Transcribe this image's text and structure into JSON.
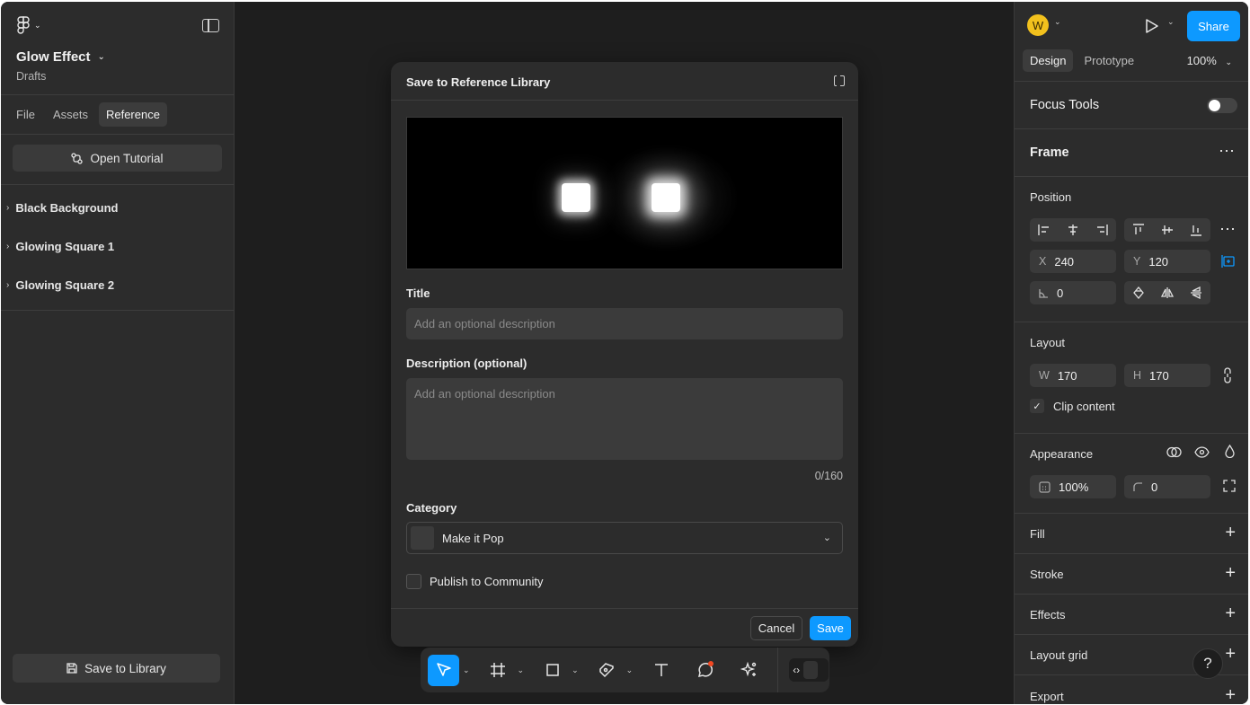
{
  "file": {
    "title": "Glow Effect",
    "location": "Drafts"
  },
  "left_tabs": [
    "File",
    "Assets",
    "Reference"
  ],
  "tutorial_button": "Open Tutorial",
  "layers": [
    "Black Background",
    "Glowing Square 1",
    "Glowing Square 2"
  ],
  "save_library_button": "Save to Library",
  "dialog": {
    "title": "Save to Reference Library",
    "title_label": "Title",
    "title_placeholder": "Add an optional description",
    "description_label": "Description (optional)",
    "description_placeholder": "Add an optional description",
    "counter": "0/160",
    "category_label": "Category",
    "category_value": "Make it Pop",
    "publish_label": "Publish to Community",
    "cancel": "Cancel",
    "save": "Save"
  },
  "toolbar": {
    "tools": [
      "move",
      "frame",
      "shape",
      "pen",
      "text",
      "comment",
      "actions",
      "dev-mode"
    ]
  },
  "right": {
    "avatar_initial": "W",
    "share": "Share",
    "tabs": [
      "Design",
      "Prototype"
    ],
    "zoom": "100%",
    "focus_tools": "Focus Tools",
    "frame": "Frame",
    "position": "Position",
    "x_label": "X",
    "x": "240",
    "y_label": "Y",
    "y": "120",
    "rotation": "0",
    "layout": "Layout",
    "w_label": "W",
    "w": "170",
    "h_label": "H",
    "h": "170",
    "clip_content": "Clip content",
    "appearance": "Appearance",
    "opacity": "100%",
    "radius": "0",
    "fill": "Fill",
    "stroke": "Stroke",
    "effects": "Effects",
    "layout_grid": "Layout grid",
    "export": "Export"
  },
  "colors": {
    "accent": "#0d99ff",
    "panel": "#2c2c2c",
    "canvas": "#1e1e1e",
    "avatar": "#f2c11d"
  }
}
